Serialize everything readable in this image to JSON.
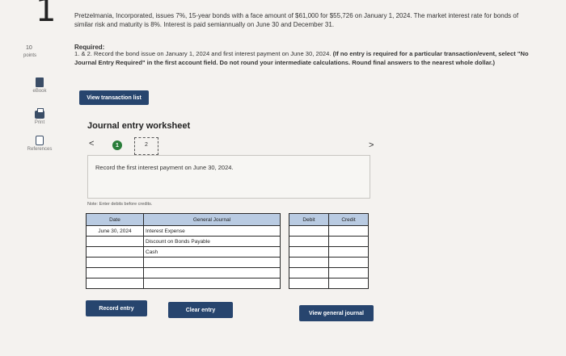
{
  "question": {
    "number": "1",
    "points_value": "10",
    "points_label": "points"
  },
  "sidebar": [
    {
      "label": "eBook",
      "icon": "ebook-icon"
    },
    {
      "label": "Print",
      "icon": "print-icon"
    },
    {
      "label": "References",
      "icon": "references-icon"
    }
  ],
  "problem_text": "Pretzelmania, Incorporated, issues 7%, 15-year bonds with a face amount of $61,000 for $55,726 on January 1, 2024. The market interest rate for bonds of similar risk and maturity is 8%. Interest is paid semiannually on June 30 and December 31.",
  "required": {
    "heading": "Required:",
    "text_plain": "1. & 2. Record the bond issue on January 1, 2024 and first interest payment on June 30, 2024.",
    "text_bold": "(If no entry is required for a particular transaction/event, select \"No Journal Entry Required\" in the first account field. Do not round your intermediate calculations. Round final answers to the nearest whole dollar.)"
  },
  "buttons": {
    "view_transaction_list": "View transaction list",
    "record_entry": "Record entry",
    "clear_entry": "Clear entry",
    "view_general_journal": "View general journal"
  },
  "worksheet": {
    "title": "Journal entry worksheet",
    "nav_prev": "<",
    "nav_next": ">",
    "step1": "1",
    "step2": "2",
    "instruction": "Record the first interest payment on June 30, 2024.",
    "note": "Note: Enter debits before credits."
  },
  "journal": {
    "headers": {
      "date": "Date",
      "account": "General Journal",
      "debit": "Debit",
      "credit": "Credit"
    },
    "rows": [
      {
        "date": "June 30, 2024",
        "account": "Interest Expense",
        "debit": "",
        "credit": ""
      },
      {
        "date": "",
        "account": "Discount on Bonds Payable",
        "debit": "",
        "credit": ""
      },
      {
        "date": "",
        "account": "Cash",
        "debit": "",
        "credit": ""
      },
      {
        "date": "",
        "account": "",
        "debit": "",
        "credit": ""
      },
      {
        "date": "",
        "account": "",
        "debit": "",
        "credit": ""
      },
      {
        "date": "",
        "account": "",
        "debit": "",
        "credit": ""
      }
    ]
  },
  "colors": {
    "button": "#27456e",
    "header": "#b9cbe2",
    "step_done": "#2a7d3a"
  }
}
